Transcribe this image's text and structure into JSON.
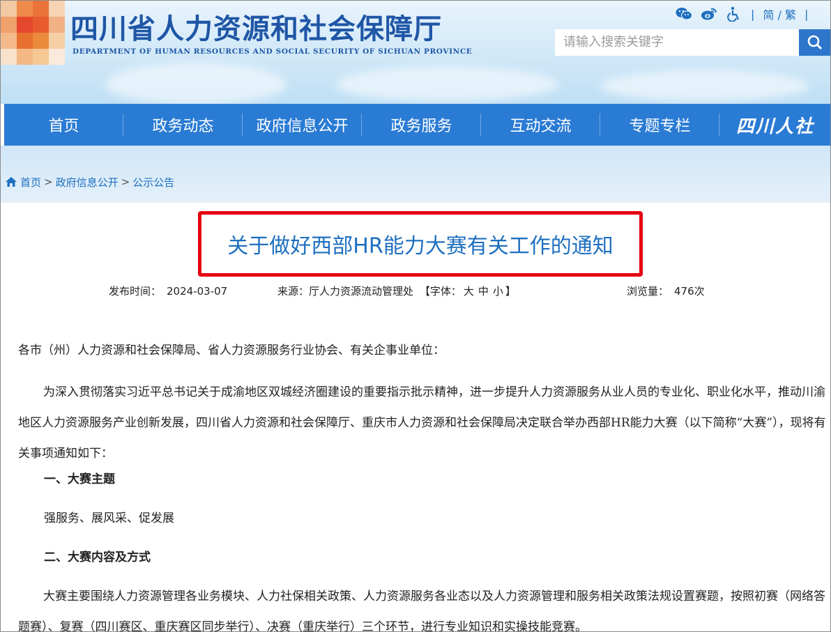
{
  "header": {
    "site_title": "四川省人力资源和社会保障厅",
    "site_subtitle": "DEPARTMENT OF HUMAN RESOURCES AND SOCIAL SECURITY OF SICHUAN PROVINCE",
    "tools": [
      "wechat-icon",
      "weibo-icon",
      "accessibility-icon"
    ],
    "separator": "|",
    "lang_label": "简 / 繁",
    "search_placeholder": "请输入搜索关键字",
    "search_icon": "search-icon"
  },
  "nav": {
    "items": [
      "首页",
      "政务动态",
      "政府信息公开",
      "政务服务",
      "互动交流",
      "专题专栏"
    ],
    "brand": "四川人社"
  },
  "breadcrumb": {
    "home_icon": "home-icon",
    "items": [
      "首页",
      "政府信息公开",
      "公示公告"
    ],
    "separator": ">"
  },
  "article": {
    "title": "关于做好西部HR能力大赛有关工作的通知",
    "publish_label": "发布时间：",
    "publish_date": "2024-03-07",
    "source_label": "来源：",
    "source": "厅人力资源流动管理处",
    "font_label_open": "【字体：",
    "font_sizes": [
      "大",
      "中",
      "小"
    ],
    "font_label_close": "】",
    "views_label": "浏览量：",
    "views": "476次",
    "paragraphs": {
      "salutation": "各市（州）人力资源和社会保障局、省人力资源服务行业协会、有关企事业单位：",
      "intro": "为深入贯彻落实习近平总书记关于成渝地区双城经济圈建设的重要指示批示精神，进一步提升人力资源服务从业人员的专业化、职业化水平，推动川渝地区人力资源服务产业创新发展，四川省人力资源和社会保障厅、重庆市人力资源和社会保障局决定联合举办西部HR能力大赛（以下简称“大赛”），现将有关事项通知如下：",
      "heading1": "一、大赛主题",
      "theme": "强服务、展风采、促发展",
      "heading2": "二、大赛内容及方式",
      "content": "大赛主要围绕人力资源管理各业务模块、人力社保相关政策、人力资源服务各业态以及人力资源管理和服务相关政策法规设置赛题，按照初赛（网络答题赛）、复赛（四川赛区、重庆赛区同步举行）、决赛（重庆举行）三个环节，进行专业知识和实操技能竞赛。"
    }
  },
  "colors": {
    "brand_blue": "#1f56a6",
    "nav_blue": "#2a7bd4",
    "link_blue": "#1e6fbf",
    "highlight_red": "#e60012"
  }
}
